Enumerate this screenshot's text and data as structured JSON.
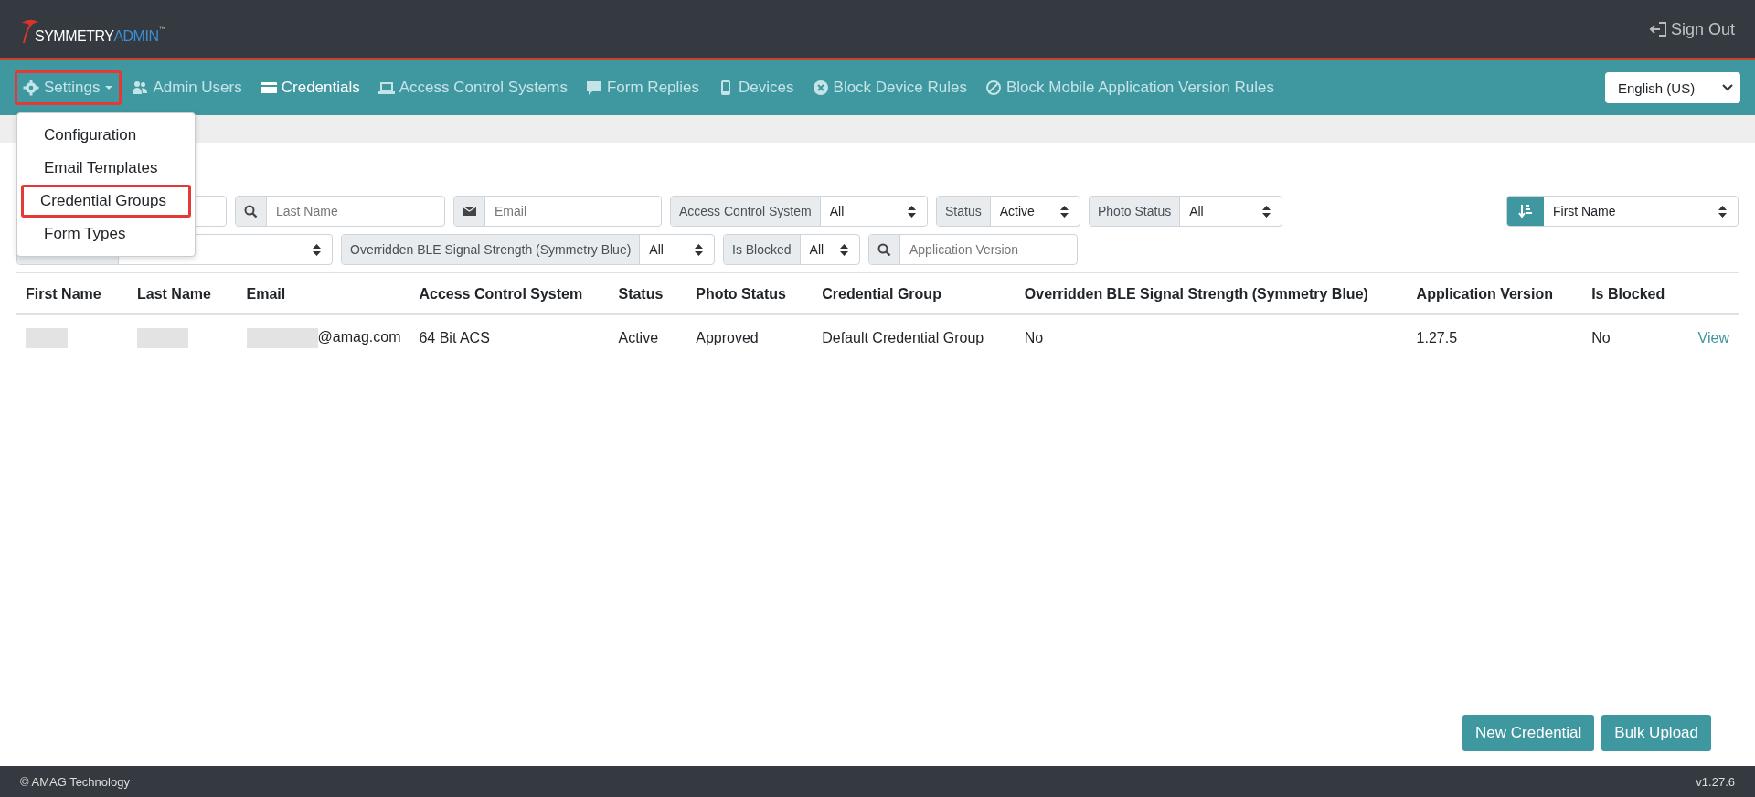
{
  "header": {
    "logo": {
      "brand": "SYMMETRY",
      "product": "ADMIN",
      "mark": "™"
    },
    "sign_out": "Sign Out"
  },
  "nav": {
    "items": [
      {
        "label": "Settings",
        "kind": "dropdown",
        "selected": false,
        "highlighted": true
      },
      {
        "label": "Admin Users",
        "kind": "link",
        "selected": false,
        "highlighted": false
      },
      {
        "label": "Credentials",
        "kind": "link",
        "selected": true,
        "highlighted": false
      },
      {
        "label": "Access Control Systems",
        "kind": "link",
        "selected": false,
        "highlighted": false
      },
      {
        "label": "Form Replies",
        "kind": "link",
        "selected": false,
        "highlighted": false
      },
      {
        "label": "Devices",
        "kind": "link",
        "selected": false,
        "highlighted": false
      },
      {
        "label": "Block Device Rules",
        "kind": "link",
        "selected": false,
        "highlighted": false
      },
      {
        "label": "Block Mobile Application Version Rules",
        "kind": "link",
        "selected": false,
        "highlighted": false
      }
    ],
    "language": "English (US)"
  },
  "settings_menu": {
    "expanded": true,
    "items": [
      {
        "label": "Configuration",
        "highlighted": false
      },
      {
        "label": "Email Templates",
        "highlighted": false
      },
      {
        "label": "Credential Groups",
        "highlighted": true
      },
      {
        "label": "Form Types",
        "highlighted": false
      }
    ]
  },
  "filters": [
    {
      "kind": "search"
    },
    {
      "kind": "search",
      "placeholder": "Last Name"
    },
    {
      "kind": "email",
      "placeholder": "Email"
    },
    {
      "kind": "select",
      "label": "Access Control System",
      "value": "All"
    },
    {
      "kind": "select",
      "label": "Status",
      "value": "Active"
    },
    {
      "kind": "select",
      "label": "Photo Status",
      "value": "All"
    },
    {
      "kind": "sort",
      "value": "First Name"
    },
    {
      "kind": "select"
    },
    {
      "kind": "select",
      "label": "Overridden BLE Signal Strength (Symmetry Blue)",
      "value": "All"
    },
    {
      "kind": "select",
      "label": "Is Blocked",
      "value": "All"
    },
    {
      "kind": "search",
      "placeholder": "Application Version"
    }
  ],
  "table": {
    "columns": [
      "First Name",
      "Last Name",
      "Email",
      "Access Control System",
      "Status",
      "Photo Status",
      "Credential Group",
      "Overridden BLE Signal Strength (Symmetry Blue)",
      "Application Version",
      "Is Blocked"
    ],
    "rows": [
      {
        "cells": [
          {
            "kind": "redacted"
          },
          {
            "kind": "redacted"
          },
          {
            "kind": "redacted",
            "text": "@amag.com"
          },
          {
            "kind": "text",
            "text": "64 Bit ACS"
          },
          {
            "kind": "text",
            "text": "Active"
          },
          {
            "kind": "text",
            "text": "Approved"
          },
          {
            "kind": "text",
            "text": "Default Credential Group"
          },
          {
            "kind": "text",
            "text": "No"
          },
          {
            "kind": "text",
            "text": "1.27.5"
          },
          {
            "kind": "text",
            "text": "No"
          }
        ],
        "action": "View"
      }
    ]
  },
  "buttons": [
    "New Credential",
    "Bulk Upload"
  ],
  "footer": {
    "copyright": "© AMAG Technology",
    "version": "v1.27.6"
  }
}
